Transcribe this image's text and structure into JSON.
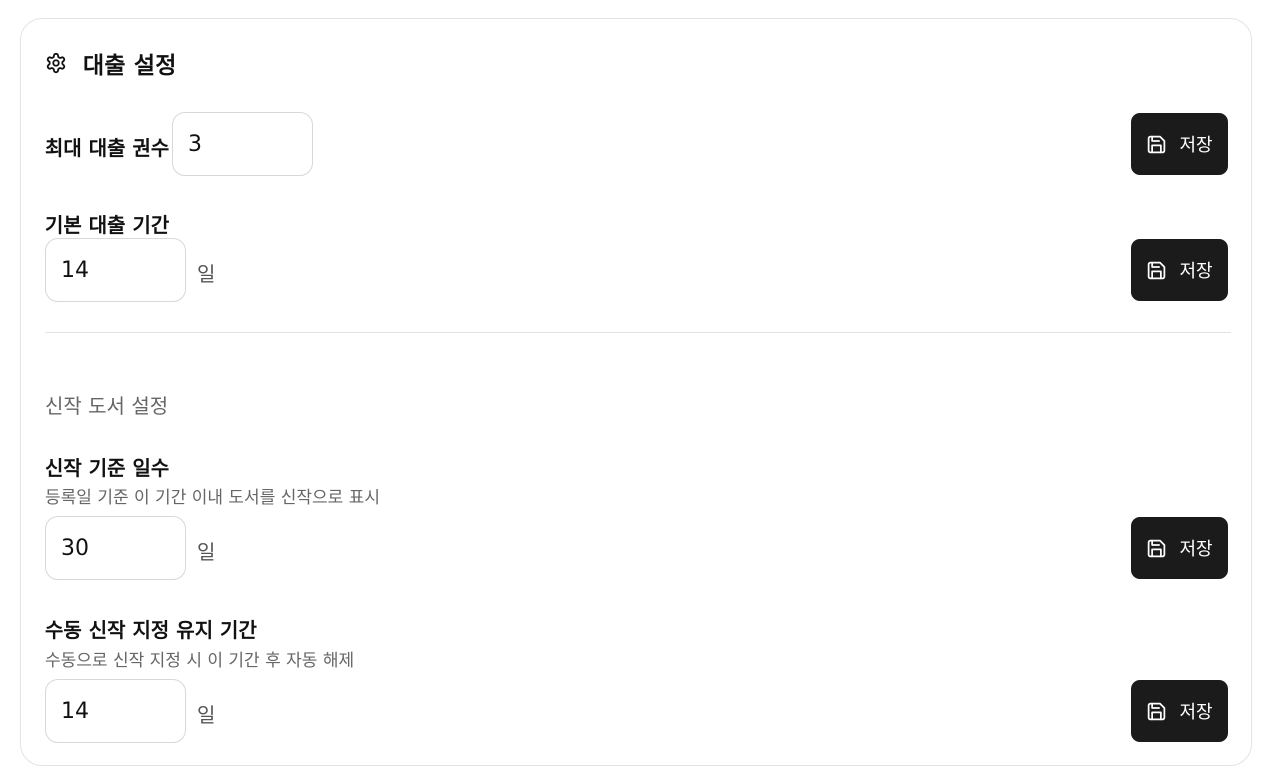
{
  "header": {
    "icon": "gear-icon",
    "title": "대출 설정"
  },
  "loan": {
    "max_books": {
      "label": "최대 대출 권수",
      "value": "3",
      "save_label": "저장"
    },
    "default_period": {
      "label": "기본 대출 기간",
      "value": "14",
      "unit": "일",
      "save_label": "저장"
    }
  },
  "new_books": {
    "section_title": "신작 도서 설정",
    "threshold_days": {
      "label": "신작 기준 일수",
      "hint": "등록일 기준 이 기간 이내 도서를 신작으로 표시",
      "value": "30",
      "unit": "일",
      "save_label": "저장"
    },
    "manual_keep": {
      "label": "수동 신작 지정 유지 기간",
      "hint": "수동으로 신작 지정 시 이 기간 후 자동 해제",
      "value": "14",
      "unit": "일",
      "save_label": "저장"
    }
  },
  "icons": {
    "save": "save-icon"
  }
}
